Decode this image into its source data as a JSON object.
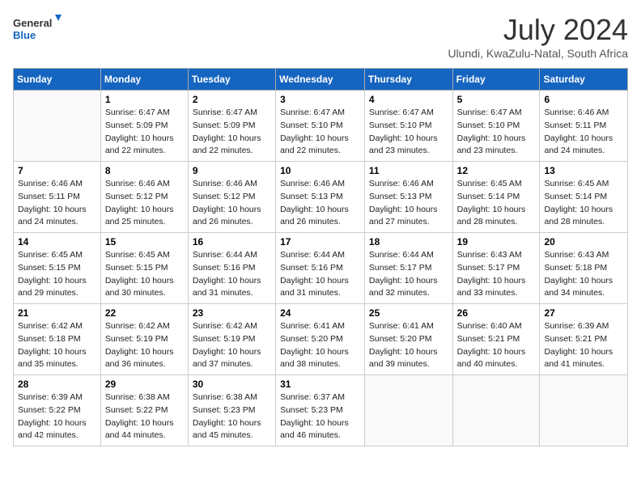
{
  "header": {
    "logo_line1": "General",
    "logo_line2": "Blue",
    "month_title": "July 2024",
    "location": "Ulundi, KwaZulu-Natal, South Africa"
  },
  "days_of_week": [
    "Sunday",
    "Monday",
    "Tuesday",
    "Wednesday",
    "Thursday",
    "Friday",
    "Saturday"
  ],
  "weeks": [
    [
      {
        "day": "",
        "sunrise": "",
        "sunset": "",
        "daylight": ""
      },
      {
        "day": "1",
        "sunrise": "6:47 AM",
        "sunset": "5:09 PM",
        "daylight": "10 hours and 22 minutes."
      },
      {
        "day": "2",
        "sunrise": "6:47 AM",
        "sunset": "5:09 PM",
        "daylight": "10 hours and 22 minutes."
      },
      {
        "day": "3",
        "sunrise": "6:47 AM",
        "sunset": "5:10 PM",
        "daylight": "10 hours and 22 minutes."
      },
      {
        "day": "4",
        "sunrise": "6:47 AM",
        "sunset": "5:10 PM",
        "daylight": "10 hours and 23 minutes."
      },
      {
        "day": "5",
        "sunrise": "6:47 AM",
        "sunset": "5:10 PM",
        "daylight": "10 hours and 23 minutes."
      },
      {
        "day": "6",
        "sunrise": "6:46 AM",
        "sunset": "5:11 PM",
        "daylight": "10 hours and 24 minutes."
      }
    ],
    [
      {
        "day": "7",
        "sunrise": "6:46 AM",
        "sunset": "5:11 PM",
        "daylight": "10 hours and 24 minutes."
      },
      {
        "day": "8",
        "sunrise": "6:46 AM",
        "sunset": "5:12 PM",
        "daylight": "10 hours and 25 minutes."
      },
      {
        "day": "9",
        "sunrise": "6:46 AM",
        "sunset": "5:12 PM",
        "daylight": "10 hours and 26 minutes."
      },
      {
        "day": "10",
        "sunrise": "6:46 AM",
        "sunset": "5:13 PM",
        "daylight": "10 hours and 26 minutes."
      },
      {
        "day": "11",
        "sunrise": "6:46 AM",
        "sunset": "5:13 PM",
        "daylight": "10 hours and 27 minutes."
      },
      {
        "day": "12",
        "sunrise": "6:45 AM",
        "sunset": "5:14 PM",
        "daylight": "10 hours and 28 minutes."
      },
      {
        "day": "13",
        "sunrise": "6:45 AM",
        "sunset": "5:14 PM",
        "daylight": "10 hours and 28 minutes."
      }
    ],
    [
      {
        "day": "14",
        "sunrise": "6:45 AM",
        "sunset": "5:15 PM",
        "daylight": "10 hours and 29 minutes."
      },
      {
        "day": "15",
        "sunrise": "6:45 AM",
        "sunset": "5:15 PM",
        "daylight": "10 hours and 30 minutes."
      },
      {
        "day": "16",
        "sunrise": "6:44 AM",
        "sunset": "5:16 PM",
        "daylight": "10 hours and 31 minutes."
      },
      {
        "day": "17",
        "sunrise": "6:44 AM",
        "sunset": "5:16 PM",
        "daylight": "10 hours and 31 minutes."
      },
      {
        "day": "18",
        "sunrise": "6:44 AM",
        "sunset": "5:17 PM",
        "daylight": "10 hours and 32 minutes."
      },
      {
        "day": "19",
        "sunrise": "6:43 AM",
        "sunset": "5:17 PM",
        "daylight": "10 hours and 33 minutes."
      },
      {
        "day": "20",
        "sunrise": "6:43 AM",
        "sunset": "5:18 PM",
        "daylight": "10 hours and 34 minutes."
      }
    ],
    [
      {
        "day": "21",
        "sunrise": "6:42 AM",
        "sunset": "5:18 PM",
        "daylight": "10 hours and 35 minutes."
      },
      {
        "day": "22",
        "sunrise": "6:42 AM",
        "sunset": "5:19 PM",
        "daylight": "10 hours and 36 minutes."
      },
      {
        "day": "23",
        "sunrise": "6:42 AM",
        "sunset": "5:19 PM",
        "daylight": "10 hours and 37 minutes."
      },
      {
        "day": "24",
        "sunrise": "6:41 AM",
        "sunset": "5:20 PM",
        "daylight": "10 hours and 38 minutes."
      },
      {
        "day": "25",
        "sunrise": "6:41 AM",
        "sunset": "5:20 PM",
        "daylight": "10 hours and 39 minutes."
      },
      {
        "day": "26",
        "sunrise": "6:40 AM",
        "sunset": "5:21 PM",
        "daylight": "10 hours and 40 minutes."
      },
      {
        "day": "27",
        "sunrise": "6:39 AM",
        "sunset": "5:21 PM",
        "daylight": "10 hours and 41 minutes."
      }
    ],
    [
      {
        "day": "28",
        "sunrise": "6:39 AM",
        "sunset": "5:22 PM",
        "daylight": "10 hours and 42 minutes."
      },
      {
        "day": "29",
        "sunrise": "6:38 AM",
        "sunset": "5:22 PM",
        "daylight": "10 hours and 44 minutes."
      },
      {
        "day": "30",
        "sunrise": "6:38 AM",
        "sunset": "5:23 PM",
        "daylight": "10 hours and 45 minutes."
      },
      {
        "day": "31",
        "sunrise": "6:37 AM",
        "sunset": "5:23 PM",
        "daylight": "10 hours and 46 minutes."
      },
      {
        "day": "",
        "sunrise": "",
        "sunset": "",
        "daylight": ""
      },
      {
        "day": "",
        "sunrise": "",
        "sunset": "",
        "daylight": ""
      },
      {
        "day": "",
        "sunrise": "",
        "sunset": "",
        "daylight": ""
      }
    ]
  ]
}
